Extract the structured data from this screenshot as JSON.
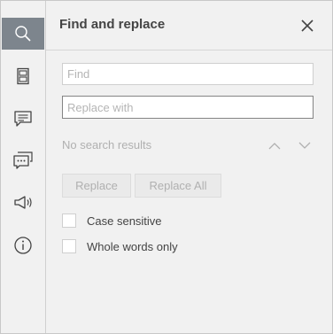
{
  "rail": {
    "items": [
      {
        "icon": "search-icon",
        "active": true
      },
      {
        "icon": "slides-icon",
        "active": false
      },
      {
        "icon": "comment-icon",
        "active": false
      },
      {
        "icon": "chat-icon",
        "active": false
      },
      {
        "icon": "megaphone-icon",
        "active": false
      },
      {
        "icon": "info-icon",
        "active": false
      }
    ]
  },
  "panel": {
    "title": "Find and replace",
    "close_icon": "close-icon"
  },
  "find": {
    "placeholder": "Find",
    "value": ""
  },
  "replace": {
    "placeholder": "Replace with",
    "value": ""
  },
  "status": {
    "text": "No search results"
  },
  "buttons": {
    "replace": "Replace",
    "replace_all": "Replace All"
  },
  "options": {
    "case_sensitive": {
      "label": "Case sensitive",
      "checked": false
    },
    "whole_words": {
      "label": "Whole words only",
      "checked": false
    }
  },
  "colors": {
    "active_rail": "#7d858d",
    "panel_bg": "#f1f1f1",
    "text": "#444444",
    "muted": "#b0b0b0"
  }
}
